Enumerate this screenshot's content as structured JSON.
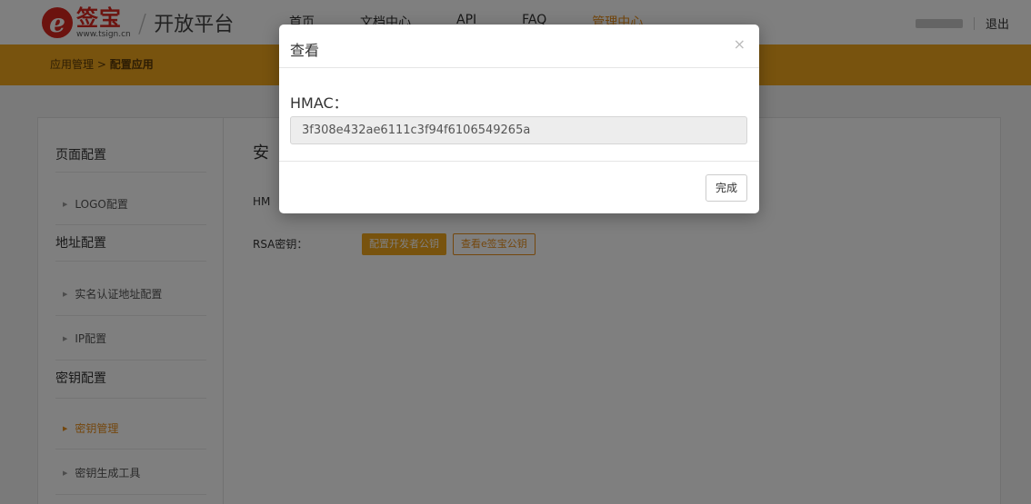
{
  "header": {
    "logo_mark": "e",
    "logo_brand": "签宝",
    "logo_url": "www.tsign.cn",
    "logo_sep": "/",
    "platform": "开放平台",
    "nav": [
      "首页",
      "文档中心",
      "API",
      "FAQ",
      "管理中心"
    ],
    "logout": "退出"
  },
  "breadcrumb": {
    "parent": "应用管理",
    "sep": ">",
    "current": "配置应用"
  },
  "sidebar": {
    "group_page": "页面配置",
    "item_logo": "LOGO配置",
    "group_address": "地址配置",
    "item_realname": "实名认证地址配置",
    "item_ip": "IP配置",
    "group_key": "密钥配置",
    "item_key_manage": "密钥管理",
    "item_key_tool": "密钥生成工具",
    "arrow": "▶"
  },
  "content": {
    "title_partial": "安",
    "hmac_label_partial": "HM",
    "rsa_label": "RSA密钥：",
    "btn_config_dev_key": "配置开发者公钥",
    "btn_view_esign_key": "查看e签宝公钥"
  },
  "modal": {
    "title": "查看",
    "close": "×",
    "field_label": "HMAC：",
    "field_value": "3f308e432ae6111c3f94f6106549265a",
    "done": "完成"
  },
  "colors": {
    "accent": "#f0a61d",
    "accent_text": "#e98e1b",
    "brand_red": "#d8261f"
  }
}
